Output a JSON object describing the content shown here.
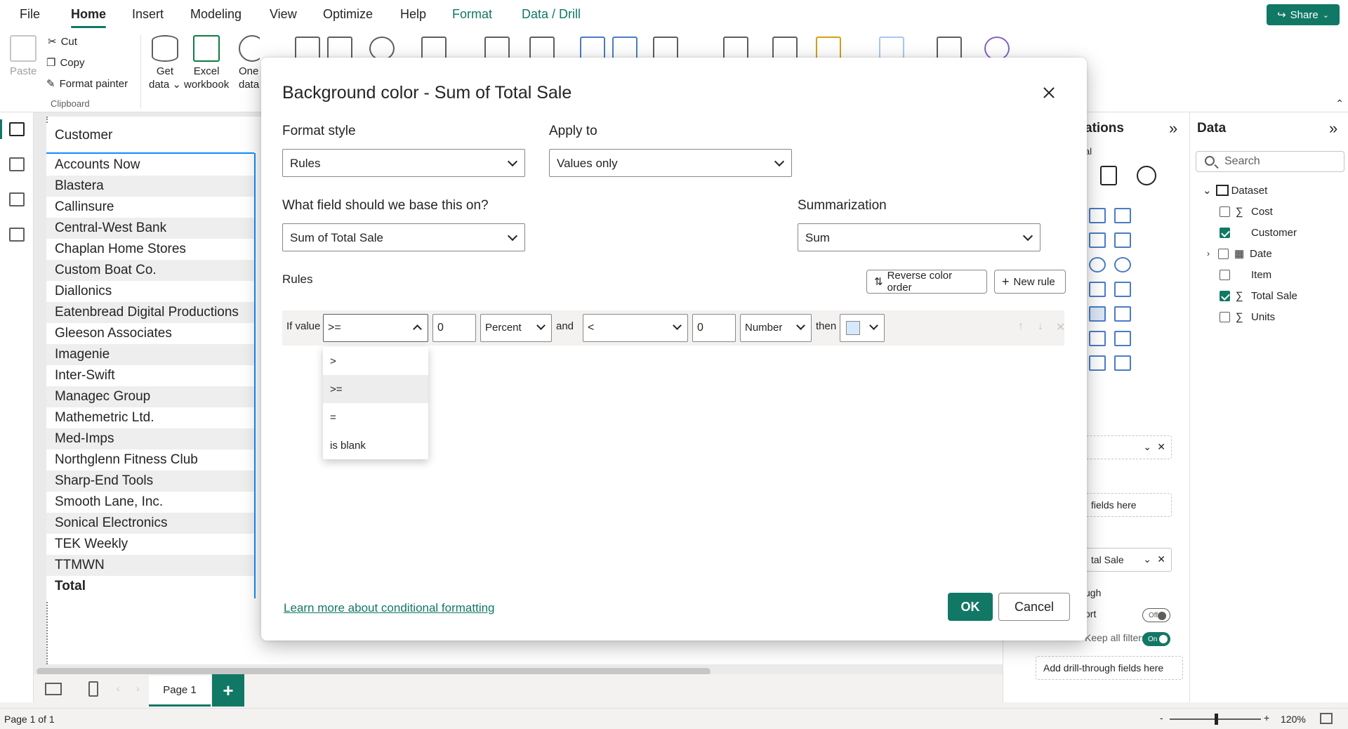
{
  "menu": {
    "tabs": [
      "File",
      "Home",
      "Insert",
      "Modeling",
      "View",
      "Optimize",
      "Help",
      "Format",
      "Data / Drill"
    ],
    "active": "Home",
    "share": "Share"
  },
  "ribbon": {
    "paste": "Paste",
    "cut": "Cut",
    "copy": "Copy",
    "format_painter": "Format painter",
    "clipboard_group": "Clipboard",
    "get_data_1": "Get",
    "get_data_2": "data",
    "excel_1": "Excel",
    "excel_2": "workbook",
    "onelake_1": "One",
    "onelake_2": "data h"
  },
  "table": {
    "header": "Customer",
    "rows": [
      "Accounts Now",
      "Blastera",
      "Callinsure",
      "Central-West Bank",
      "Chaplan Home Stores",
      "Custom Boat Co.",
      "Diallonics",
      "Eatenbread Digital Productions",
      "Gleeson Associates",
      "Imagenie",
      "Inter-Swift",
      "Managec Group",
      "Mathemetric Ltd.",
      "Med-Imps",
      "Northglenn Fitness Club",
      "Sharp-End Tools",
      "Smooth Lane, Inc.",
      "Sonical Electronics",
      "TEK Weekly",
      "TTMWN"
    ],
    "total": "Total"
  },
  "viz_pane": {
    "title": "ations",
    "sub": "al",
    "well_1": "",
    "well_2": "fields here",
    "well_3": "tal Sale",
    "drill_label": "ugh",
    "cross_report": "ort",
    "cross_toggle": "Off",
    "keep_filters": "Keep all filters",
    "keep_toggle": "On",
    "add_drill": "Add drill-through fields here"
  },
  "data_pane": {
    "title": "Data",
    "search_placeholder": "Search",
    "dataset": "Dataset",
    "fields": [
      {
        "name": "Cost",
        "sigma": true,
        "checked": false
      },
      {
        "name": "Customer",
        "sigma": false,
        "checked": true
      },
      {
        "name": "Date",
        "sigma": false,
        "checked": false,
        "table": true
      },
      {
        "name": "Item",
        "sigma": false,
        "checked": false
      },
      {
        "name": "Total Sale",
        "sigma": true,
        "checked": true
      },
      {
        "name": "Units",
        "sigma": true,
        "checked": false
      }
    ]
  },
  "pages": {
    "tab": "Page 1",
    "add": "+"
  },
  "status": {
    "page": "Page 1 of 1",
    "zoom": "120%",
    "zoom_level": 0.6
  },
  "dialog": {
    "title": "Background color - Sum of Total Sale",
    "format_style_label": "Format style",
    "format_style_value": "Rules",
    "apply_to_label": "Apply to",
    "apply_to_value": "Values only",
    "base_field_label": "What field should we base this on?",
    "base_field_value": "Sum of Total Sale",
    "summarization_label": "Summarization",
    "summarization_value": "Sum",
    "rules_label": "Rules",
    "reverse_btn": "Reverse color order",
    "new_rule_btn": "New rule",
    "rule": {
      "if_value": "If value",
      "op1": ">=",
      "val1": "0",
      "type1": "Percent",
      "and": "and",
      "op2": "<",
      "val2": "0",
      "type2": "Number",
      "then": "then",
      "color": "#d6e9ff"
    },
    "operator_options": [
      ">",
      ">=",
      "=",
      "is blank"
    ],
    "selected_option": ">=",
    "learn_more": "Learn more about conditional formatting",
    "ok": "OK",
    "cancel": "Cancel"
  }
}
